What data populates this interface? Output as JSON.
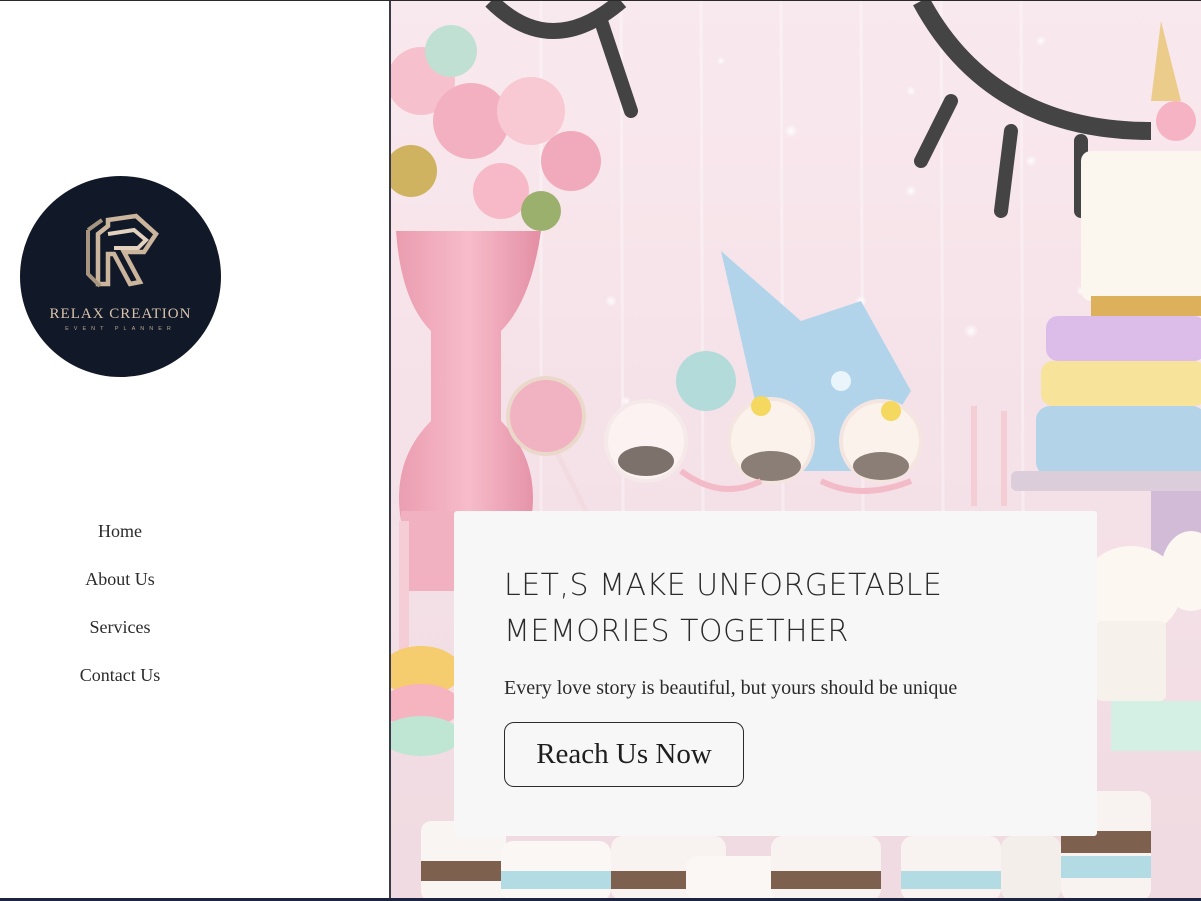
{
  "brand": {
    "name": "RELAX CREATION",
    "tagline": "EVENT PLANNER"
  },
  "nav": {
    "items": [
      {
        "label": "Home"
      },
      {
        "label": "About Us"
      },
      {
        "label": "Services"
      },
      {
        "label": "Contact Us"
      }
    ]
  },
  "hero": {
    "title": "LET,S MAKE UNFORGETABLE MEMORIES TOGETHER",
    "subtitle": "Every love story is beautiful, but yours should be unique",
    "cta_label": "Reach Us Now"
  },
  "colors": {
    "logo_background": "#111828",
    "logo_gold": "#d7c3ab",
    "card_background": "#f7f7f7",
    "text": "#2b2b2b"
  }
}
